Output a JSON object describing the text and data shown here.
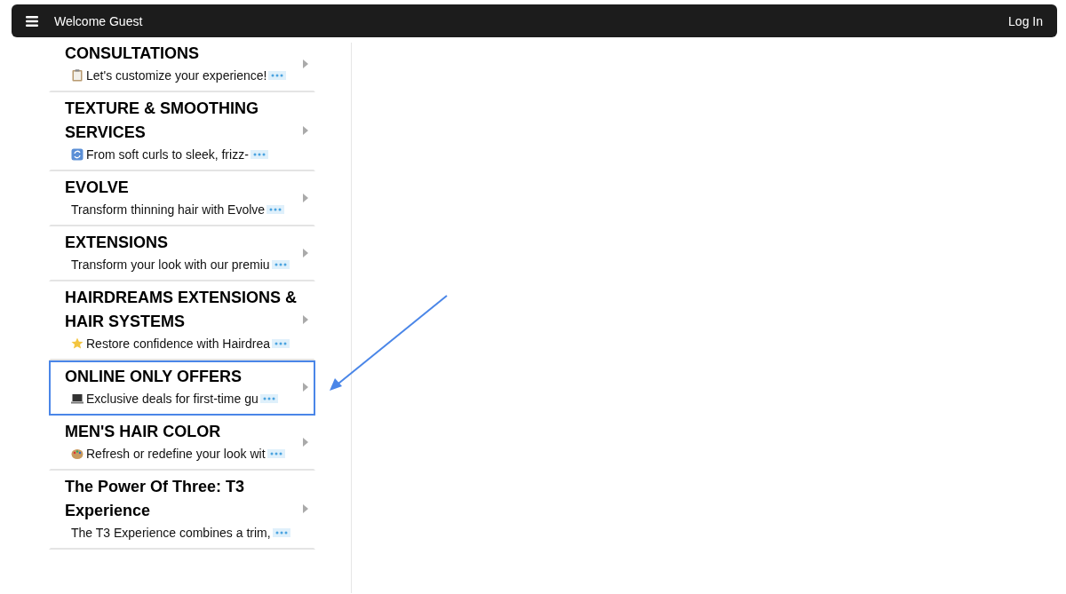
{
  "header": {
    "greeting": "Welcome Guest",
    "login": "Log In"
  },
  "services": [
    {
      "title": "CONSULTATIONS",
      "kind": "clipboard",
      "description": "Let's customize your experience!",
      "highlighted": false
    },
    {
      "title": "TEXTURE & SMOOTHING SERVICES",
      "kind": "refresh",
      "description": "From soft curls to sleek, frizz-",
      "highlighted": false
    },
    {
      "title": "EVOLVE",
      "description": "Transform thinning hair with Evolve",
      "highlighted": false
    },
    {
      "title": "EXTENSIONS",
      "description": "Transform your look with our premiu",
      "highlighted": false
    },
    {
      "title": "HAIRDREAMS EXTENSIONS & HAIR SYSTEMS",
      "kind": "star",
      "description": "Restore confidence with Hairdrea",
      "highlighted": false
    },
    {
      "title": "ONLINE ONLY OFFERS",
      "kind": "laptop",
      "description": "Exclusive deals for first-time gu",
      "highlighted": true
    },
    {
      "title": "MEN'S HAIR COLOR",
      "kind": "palette",
      "description": "Refresh or redefine your look wit",
      "highlighted": false
    },
    {
      "title": "The Power Of Three: T3 Experience",
      "description": "The T3 Experience combines a trim,",
      "highlighted": false
    }
  ]
}
